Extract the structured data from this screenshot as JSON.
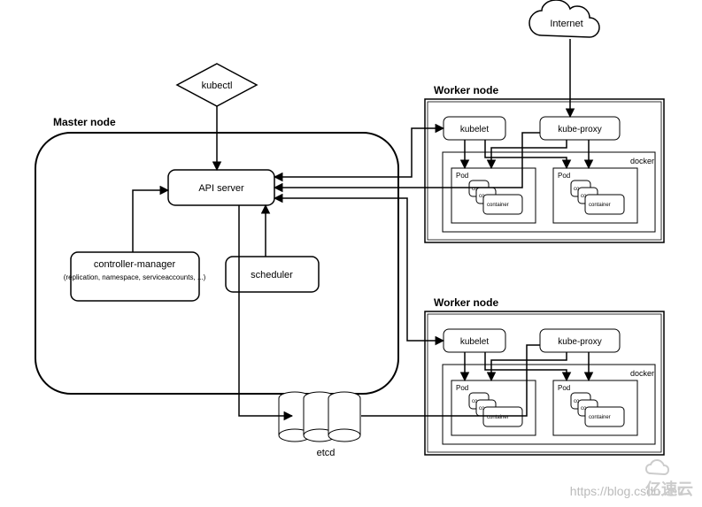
{
  "internet": "Internet",
  "kubectl": "kubectl",
  "master": {
    "title": "Master node",
    "api": "API server",
    "controller": "controller-manager",
    "controller_sub": "(replication, namespace, serviceaccounts, ...)",
    "scheduler": "scheduler",
    "etcd": "etcd"
  },
  "worker": {
    "title": "Worker node",
    "kubelet": "kubelet",
    "kubeproxy": "kube-proxy",
    "docker": "docker",
    "pod": "Pod",
    "container": "container",
    "co": "co"
  },
  "watermark": "https://blog.csdn.net/",
  "brand": "亿速云"
}
